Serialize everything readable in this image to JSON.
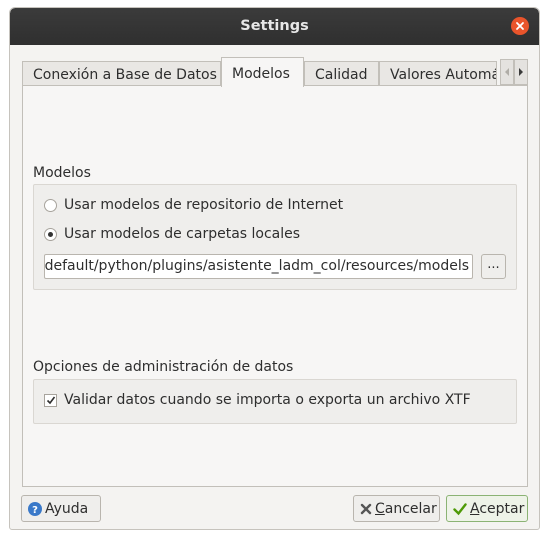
{
  "window": {
    "title": "Settings"
  },
  "tabs": [
    {
      "label": "Conexión a Base de Datos",
      "active": false
    },
    {
      "label": "Modelos",
      "active": true
    },
    {
      "label": "Calidad",
      "active": false
    },
    {
      "label": "Valores Automáticos",
      "active": false
    }
  ],
  "models": {
    "section_title": "Modelos",
    "options": [
      {
        "label": "Usar modelos de repositorio de Internet",
        "selected": false
      },
      {
        "label": "Usar modelos de carpetas locales",
        "selected": true
      }
    ],
    "path_value": "/default/python/plugins/asistente_ladm_col/resources/models",
    "browse_label": "..."
  },
  "data_admin": {
    "section_title": "Opciones de administración de datos",
    "validate_label": "Validar datos cuando se importa o exporta un archivo XTF",
    "validate_checked": true
  },
  "buttons": {
    "help": "Ayuda",
    "cancel_prefix": "",
    "cancel_mnemonic": "C",
    "cancel_rest": "ancelar",
    "accept_mnemonic": "A",
    "accept_rest": "ceptar"
  },
  "colors": {
    "close": "#e9542b",
    "titlebar": "#333333",
    "accept_border": "#8bb374",
    "help_icon": "#3a79c9"
  }
}
